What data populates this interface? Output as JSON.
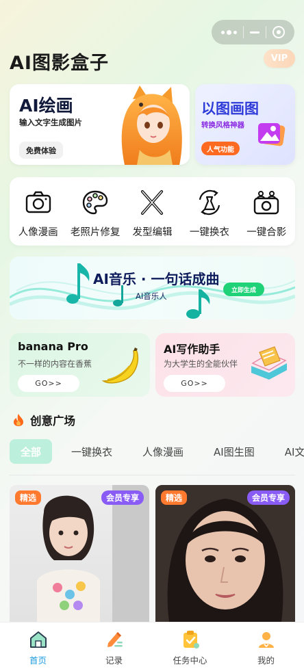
{
  "header": {
    "app_title": "AI图影盒子",
    "vip_label": "VIP"
  },
  "feature_cards": {
    "ai_paint": {
      "title": "AI绘画",
      "subtitle": "输入文字生成图片",
      "button": "免费体验"
    },
    "img2img": {
      "title": "以图画图",
      "subtitle": "转换风格神器",
      "tag": "人气功能"
    }
  },
  "tools": [
    {
      "label": "人像漫画",
      "icon": "camera-icon"
    },
    {
      "label": "老照片修复",
      "icon": "palette-icon"
    },
    {
      "label": "发型编辑",
      "icon": "scissors-icon"
    },
    {
      "label": "一键换衣",
      "icon": "outfit-swap-icon"
    },
    {
      "label": "一键合影",
      "icon": "group-camera-icon"
    }
  ],
  "music_banner": {
    "title": "AI音乐 · 一句话成曲",
    "subtitle": "AI音乐人",
    "button": "立即生成"
  },
  "promos": {
    "banana": {
      "title": "banana Pro",
      "subtitle": "不一样的内容在香蕉",
      "button": "GO>>"
    },
    "writer": {
      "title": "AI写作助手",
      "subtitle": "为大学生的全能伙伴",
      "button": "GO>>"
    }
  },
  "creative": {
    "section_title": "创意广场",
    "tabs": [
      "全部",
      "一键换衣",
      "人像漫画",
      "AI图生图",
      "AI文"
    ],
    "active_tab": "全部",
    "cards": [
      {
        "pick_label": "精选",
        "member_label": "会员专享"
      },
      {
        "pick_label": "精选",
        "member_label": "会员专享"
      }
    ]
  },
  "tabbar": [
    {
      "label": "首页",
      "icon": "home-icon",
      "active": true
    },
    {
      "label": "记录",
      "icon": "pencil-record-icon",
      "active": false
    },
    {
      "label": "任务中心",
      "icon": "clipboard-task-icon",
      "active": false
    },
    {
      "label": "我的",
      "icon": "user-icon",
      "active": false
    }
  ],
  "colors": {
    "accent_green": "#20d277",
    "active_tab_bg": "#bdf0dc",
    "tabbar_active": "#1f9de0",
    "pick_orange": "#ff7a2e",
    "member_purple": "#8a5cf6"
  }
}
